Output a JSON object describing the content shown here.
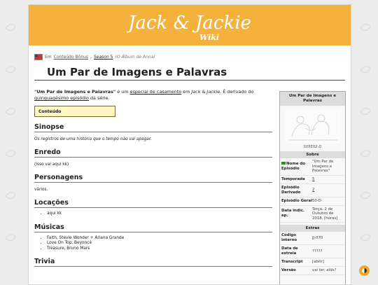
{
  "banner": {
    "logo_text": "Jack & Jackie",
    "logo_sub": "Wiki",
    "bg_color": "#f4b13b"
  },
  "breadcrumb": {
    "prefix": "Em",
    "category": "Conteúdo Bônus",
    "sep": ",",
    "season": "Season 5",
    "extra": "(O Álbum de Anna)"
  },
  "page": {
    "title": "Um Par de Imagens e Palavras"
  },
  "intro": {
    "bold": "\"Um Par de Imagens e Palavras\"",
    "t1": " é um ",
    "link1": "especial de casamento",
    "t2": " em ",
    "it1": "Jack & Jackie",
    "t3": ". É derivado do ",
    "link2": "quinquagésimo episódio",
    "t4": " da série."
  },
  "toc": {
    "label": "Conteúdo"
  },
  "sections": [
    {
      "title": "Sinopse",
      "text": "Os registros de uma história que o tempo não vai apagar.",
      "italic": true
    },
    {
      "title": "Enredo",
      "text": "(Isso vai aqui kk)"
    },
    {
      "title": "Personagens",
      "text": "vários."
    },
    {
      "title": "Locações",
      "items": [
        "aqui kk"
      ]
    },
    {
      "title": "Músicas",
      "items": [
        "Faith, Stevie Wonder + Ariana Grande",
        "Love On Top, Beyoncé",
        "Treasure, Bruno Mars"
      ]
    },
    {
      "title": "Trivia"
    }
  ],
  "infobox": {
    "title": "Um Par de Imagens e Palavras",
    "caption": "S05E02-D",
    "sobre_head": "Sobre",
    "rows": [
      {
        "k": "Nome do Episódio",
        "v": "\"Um Par de Imagens e Palavras\""
      },
      {
        "k": "Temporada",
        "v": "5"
      },
      {
        "k": "Episódio Derivado",
        "v": "2"
      },
      {
        "k": "Episódio Geral",
        "v": "50-D"
      },
      {
        "k": "Data indic. ep.",
        "v": "Terça, 2 de Outubro de 2018, [horas]"
      }
    ],
    "extras_head": "Extras",
    "extras": [
      {
        "k": "Código interno",
        "v": "JJ-070"
      },
      {
        "k": "Data de estreia",
        "v": "?????"
      },
      {
        "k": "Transcript",
        "v": "[abrir]"
      },
      {
        "k": "Versão",
        "v": "vai ter, aîds?"
      }
    ]
  }
}
